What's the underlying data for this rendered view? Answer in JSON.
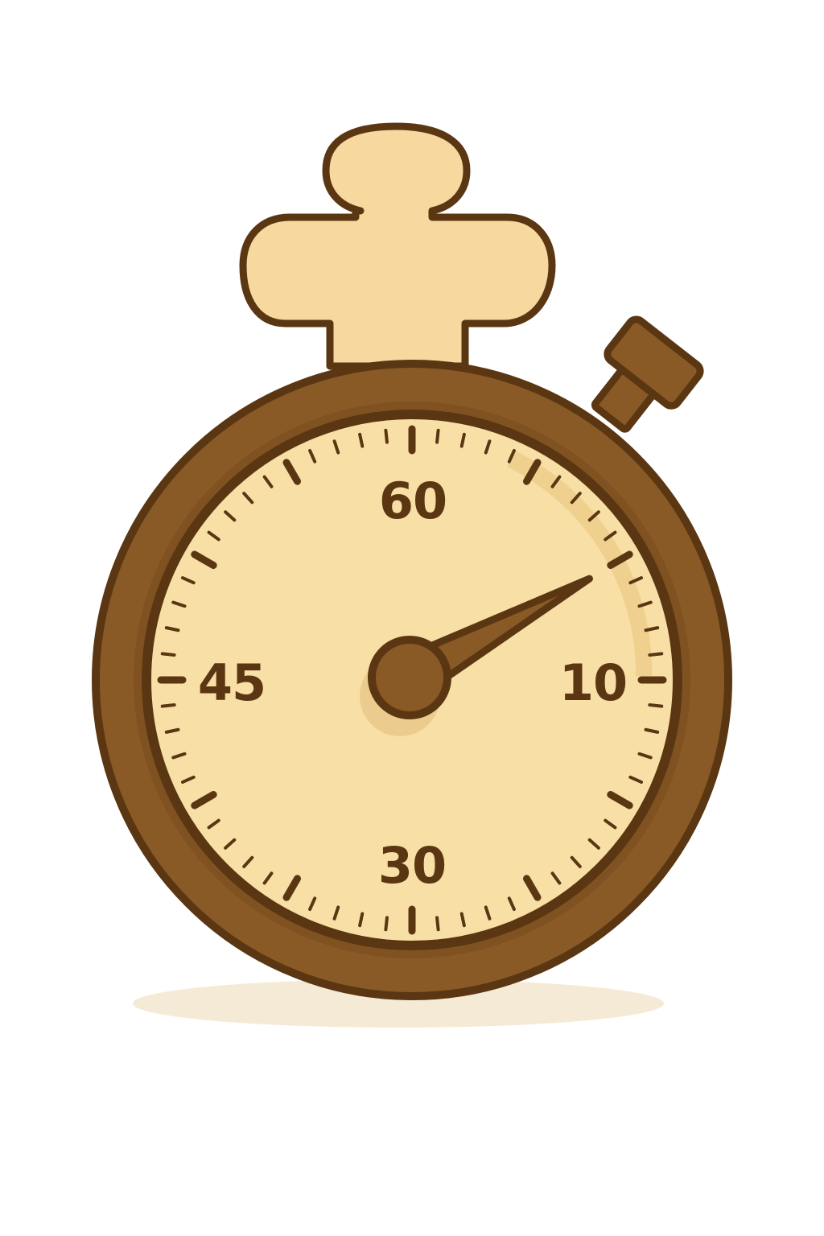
{
  "stopwatch": {
    "dial_labels": {
      "top": "60",
      "right": "10",
      "bottom": "30",
      "left": "45"
    },
    "tick_count": 60,
    "hand_position_fraction": 0.17,
    "colors": {
      "outline": "#5a3712",
      "case": "#8a5a26",
      "case_shade": "#6e4519",
      "face": "#f8dfa6",
      "face_rim_shadow": "#ecc985",
      "knob": "#f7d9a0",
      "text": "#5a3712",
      "background": "#ffffff"
    }
  }
}
